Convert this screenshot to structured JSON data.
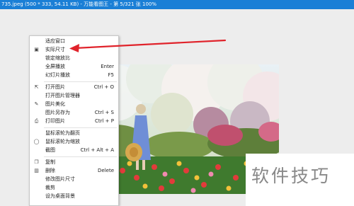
{
  "window": {
    "title": "735.jpeg (500 * 333, 54.11 KB) - 万能看图王 - 第 5/321 张 100%"
  },
  "menu": {
    "items": [
      {
        "label": "适应窗口",
        "shortcut": "",
        "icon": ""
      },
      {
        "label": "实际尺寸",
        "shortcut": "",
        "icon": "actual-size-icon"
      },
      {
        "label": "锁定缩放比",
        "shortcut": "",
        "icon": ""
      },
      {
        "label": "全屏播放",
        "shortcut": "Enter",
        "icon": ""
      },
      {
        "label": "幻灯片播放",
        "shortcut": "F5",
        "icon": ""
      },
      {
        "label": "打开图片",
        "shortcut": "Ctrl + O",
        "icon": "open-icon"
      },
      {
        "label": "打开图片管理器",
        "shortcut": "",
        "icon": ""
      },
      {
        "label": "图片美化",
        "shortcut": "",
        "icon": "beautify-icon"
      },
      {
        "label": "图片另存为",
        "shortcut": "Ctrl + S",
        "icon": ""
      },
      {
        "label": "打印图片",
        "shortcut": "Ctrl + P",
        "icon": "print-icon"
      },
      {
        "label": "鼠标滚轮为翻页",
        "shortcut": "",
        "icon": ""
      },
      {
        "label": "鼠标滚轮为缩放",
        "shortcut": "",
        "icon": "mouse-icon"
      },
      {
        "label": "截图",
        "shortcut": "Ctrl + Alt + A",
        "icon": ""
      },
      {
        "label": "复制",
        "shortcut": "",
        "icon": "copy-icon"
      },
      {
        "label": "删除",
        "shortcut": "Delete",
        "icon": "trash-icon"
      },
      {
        "label": "修改图片尺寸",
        "shortcut": "",
        "icon": ""
      },
      {
        "label": "裁剪",
        "shortcut": "",
        "icon": ""
      },
      {
        "label": "设为桌面背景",
        "shortcut": "",
        "icon": ""
      }
    ]
  },
  "watermark": {
    "text": "软件技巧"
  },
  "colors": {
    "titlebar": "#1a7fd6",
    "arrow": "#e0232b",
    "menu_bg": "#ffffff"
  }
}
